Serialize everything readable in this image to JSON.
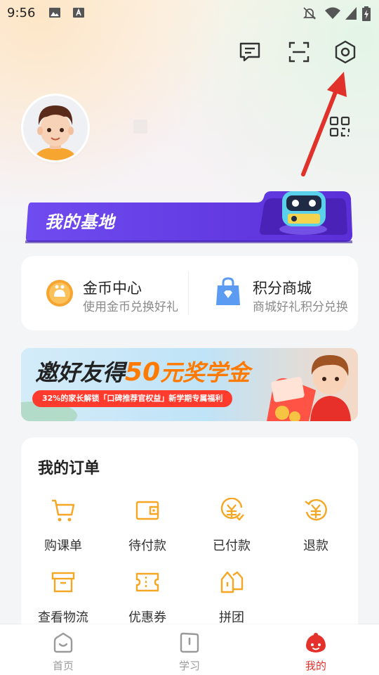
{
  "status_bar": {
    "time": "9:56"
  },
  "header": {
    "icons": [
      "message-icon",
      "scan-icon",
      "settings-icon"
    ]
  },
  "profile": {
    "avatar": "avatar",
    "qr": "qr-code-icon"
  },
  "base_banner": {
    "title": "我的基地"
  },
  "quick_card": {
    "items": [
      {
        "title": "金币中心",
        "subtitle": "使用金币兑换好礼",
        "icon": "coin-icon"
      },
      {
        "title": "积分商城",
        "subtitle": "商城好礼积分兑换",
        "icon": "shopping-bag-icon"
      }
    ]
  },
  "promo": {
    "title_part1": "邀好友得",
    "title_part2": "50",
    "title_part3": "元奖学金",
    "subtitle": "32%的家长解锁「口碑推荐官权益」新学期专属福利"
  },
  "orders": {
    "title": "我的订单",
    "items": [
      {
        "label": "购课单",
        "icon": "cart-icon"
      },
      {
        "label": "待付款",
        "icon": "wallet-icon"
      },
      {
        "label": "已付款",
        "icon": "paid-icon"
      },
      {
        "label": "退款",
        "icon": "refund-icon"
      },
      {
        "label": "查看物流",
        "icon": "box-icon"
      },
      {
        "label": "优惠券",
        "icon": "coupon-icon"
      },
      {
        "label": "拼团",
        "icon": "group-buy-icon"
      }
    ]
  },
  "tabbar": {
    "items": [
      {
        "label": "首页",
        "icon": "home-icon"
      },
      {
        "label": "学习",
        "icon": "study-icon"
      },
      {
        "label": "我的",
        "icon": "mine-icon",
        "active": true
      }
    ]
  },
  "colors": {
    "accent": "#F5A623",
    "active_tab": "#E5312B",
    "banner_purple": "#6A3BE4",
    "arrow_red": "#E0322B"
  }
}
